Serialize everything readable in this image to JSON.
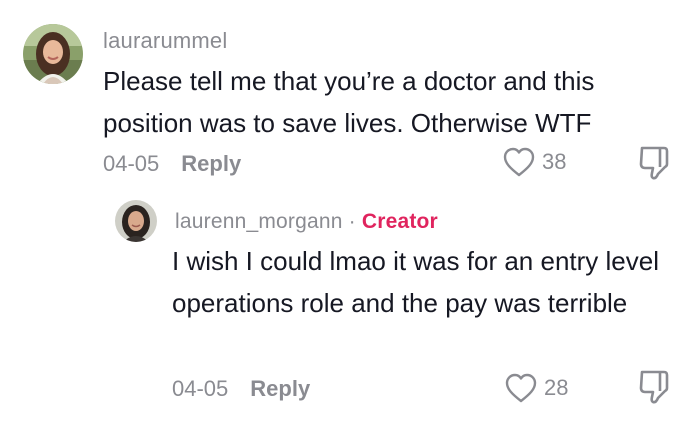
{
  "comments": [
    {
      "username": "laurarummel",
      "text": "Please tell me that you’re a doctor and this position was to save lives. Otherwise WTF",
      "date": "04-05",
      "reply_label": "Reply",
      "likes": "38",
      "avatar_icon": "avatar-woman-long-hair",
      "like_icon": "heart-outline-icon",
      "dislike_icon": "thumbs-down-outline-icon"
    },
    {
      "username": "laurenn_morgann",
      "separator": "·",
      "badge": "Creator",
      "text": "I wish I could lmao it was for an entry level operations role and the pay was terrible",
      "date": "04-05",
      "reply_label": "Reply",
      "likes": "28",
      "avatar_icon": "avatar-woman-dark-hair",
      "like_icon": "heart-outline-icon",
      "dislike_icon": "thumbs-down-outline-icon"
    }
  ],
  "colors": {
    "muted": "#8a8b91",
    "text": "#161823",
    "creator_badge": "#e0245e"
  }
}
